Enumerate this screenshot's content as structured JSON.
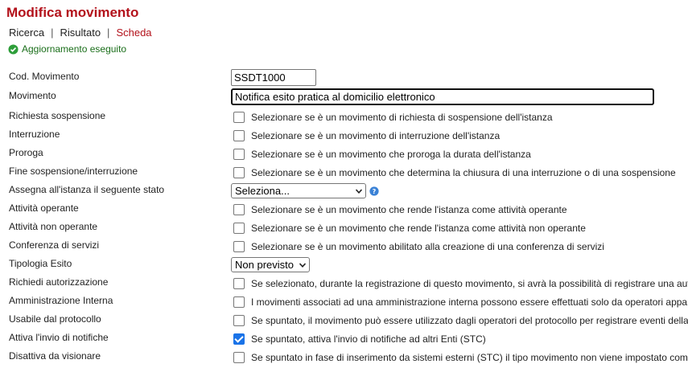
{
  "header": {
    "title": "Modifica movimento",
    "breadcrumb": {
      "search": "Ricerca",
      "sep1": "|",
      "result": "Risultato",
      "sep2": "|",
      "current": "Scheda"
    },
    "status": "Aggiornamento eseguito"
  },
  "form": {
    "cod_movimento": {
      "label": "Cod. Movimento",
      "value": "SSDT1000"
    },
    "movimento": {
      "label": "Movimento",
      "value": "Notifica esito pratica al domicilio elettronico"
    },
    "richiesta_sospensione": {
      "label": "Richiesta sospensione",
      "desc": "Selezionare se è un movimento di richiesta di sospensione dell'istanza",
      "checked": false
    },
    "interruzione": {
      "label": "Interruzione",
      "desc": "Selezionare se è un movimento di interruzione dell'istanza",
      "checked": false
    },
    "proroga": {
      "label": "Proroga",
      "desc": "Selezionare se è un movimento che proroga la durata dell'istanza",
      "checked": false
    },
    "fine_sospensione": {
      "label": "Fine sospensione/interruzione",
      "desc": "Selezionare se è un movimento che determina la chiusura di una interruzione o di una sospensione",
      "checked": false
    },
    "assegna_stato": {
      "label": "Assegna all'istanza il seguente stato",
      "selected": "Seleziona..."
    },
    "attivita_operante": {
      "label": "Attività operante",
      "desc": "Selezionare se è un movimento che rende l'istanza come attività operante",
      "checked": false
    },
    "attivita_non_operante": {
      "label": "Attività non operante",
      "desc": "Selezionare se è un movimento che rende l'istanza come attività non operante",
      "checked": false
    },
    "conferenza_servizi": {
      "label": "Conferenza di servizi",
      "desc": "Selezionare se è un movimento abilitato alla creazione di una conferenza di servizi",
      "checked": false
    },
    "tipologia_esito": {
      "label": "Tipologia Esito",
      "selected": "Non previsto"
    },
    "richiedi_autorizzazione": {
      "label": "Richiedi autorizzazione",
      "desc": "Se selezionato, durante la registrazione di questo movimento, si avrà la possibilità di registrare una autoriz",
      "checked": false
    },
    "amministrazione_interna": {
      "label": "Amministrazione Interna",
      "desc": "I movimenti associati ad una amministrazione interna possono essere effettuati solo da operatori apparten",
      "checked": false
    },
    "usabile_protocollo": {
      "label": "Usabile dal protocollo",
      "desc": "Se spuntato, il movimento può essere utilizzato dagli operatori del protocollo per registrare eventi della pra",
      "checked": false
    },
    "invio_notifiche": {
      "label": "Attiva l'invio di notifiche",
      "desc": "Se spuntato, attiva l'invio di notifiche ad altri Enti (STC)",
      "checked": true
    },
    "disattiva_visionare": {
      "label": "Disattiva da visionare",
      "desc": "Se spuntato in fase di inserimento da sistemi esterni (STC) il tipo movimento non viene impostato come \"D",
      "checked": false
    }
  },
  "colors": {
    "accent": "#b3121b",
    "success": "#2e9e3a",
    "checkbox_checked": "#1a73e8",
    "help": "#3b82d6"
  }
}
